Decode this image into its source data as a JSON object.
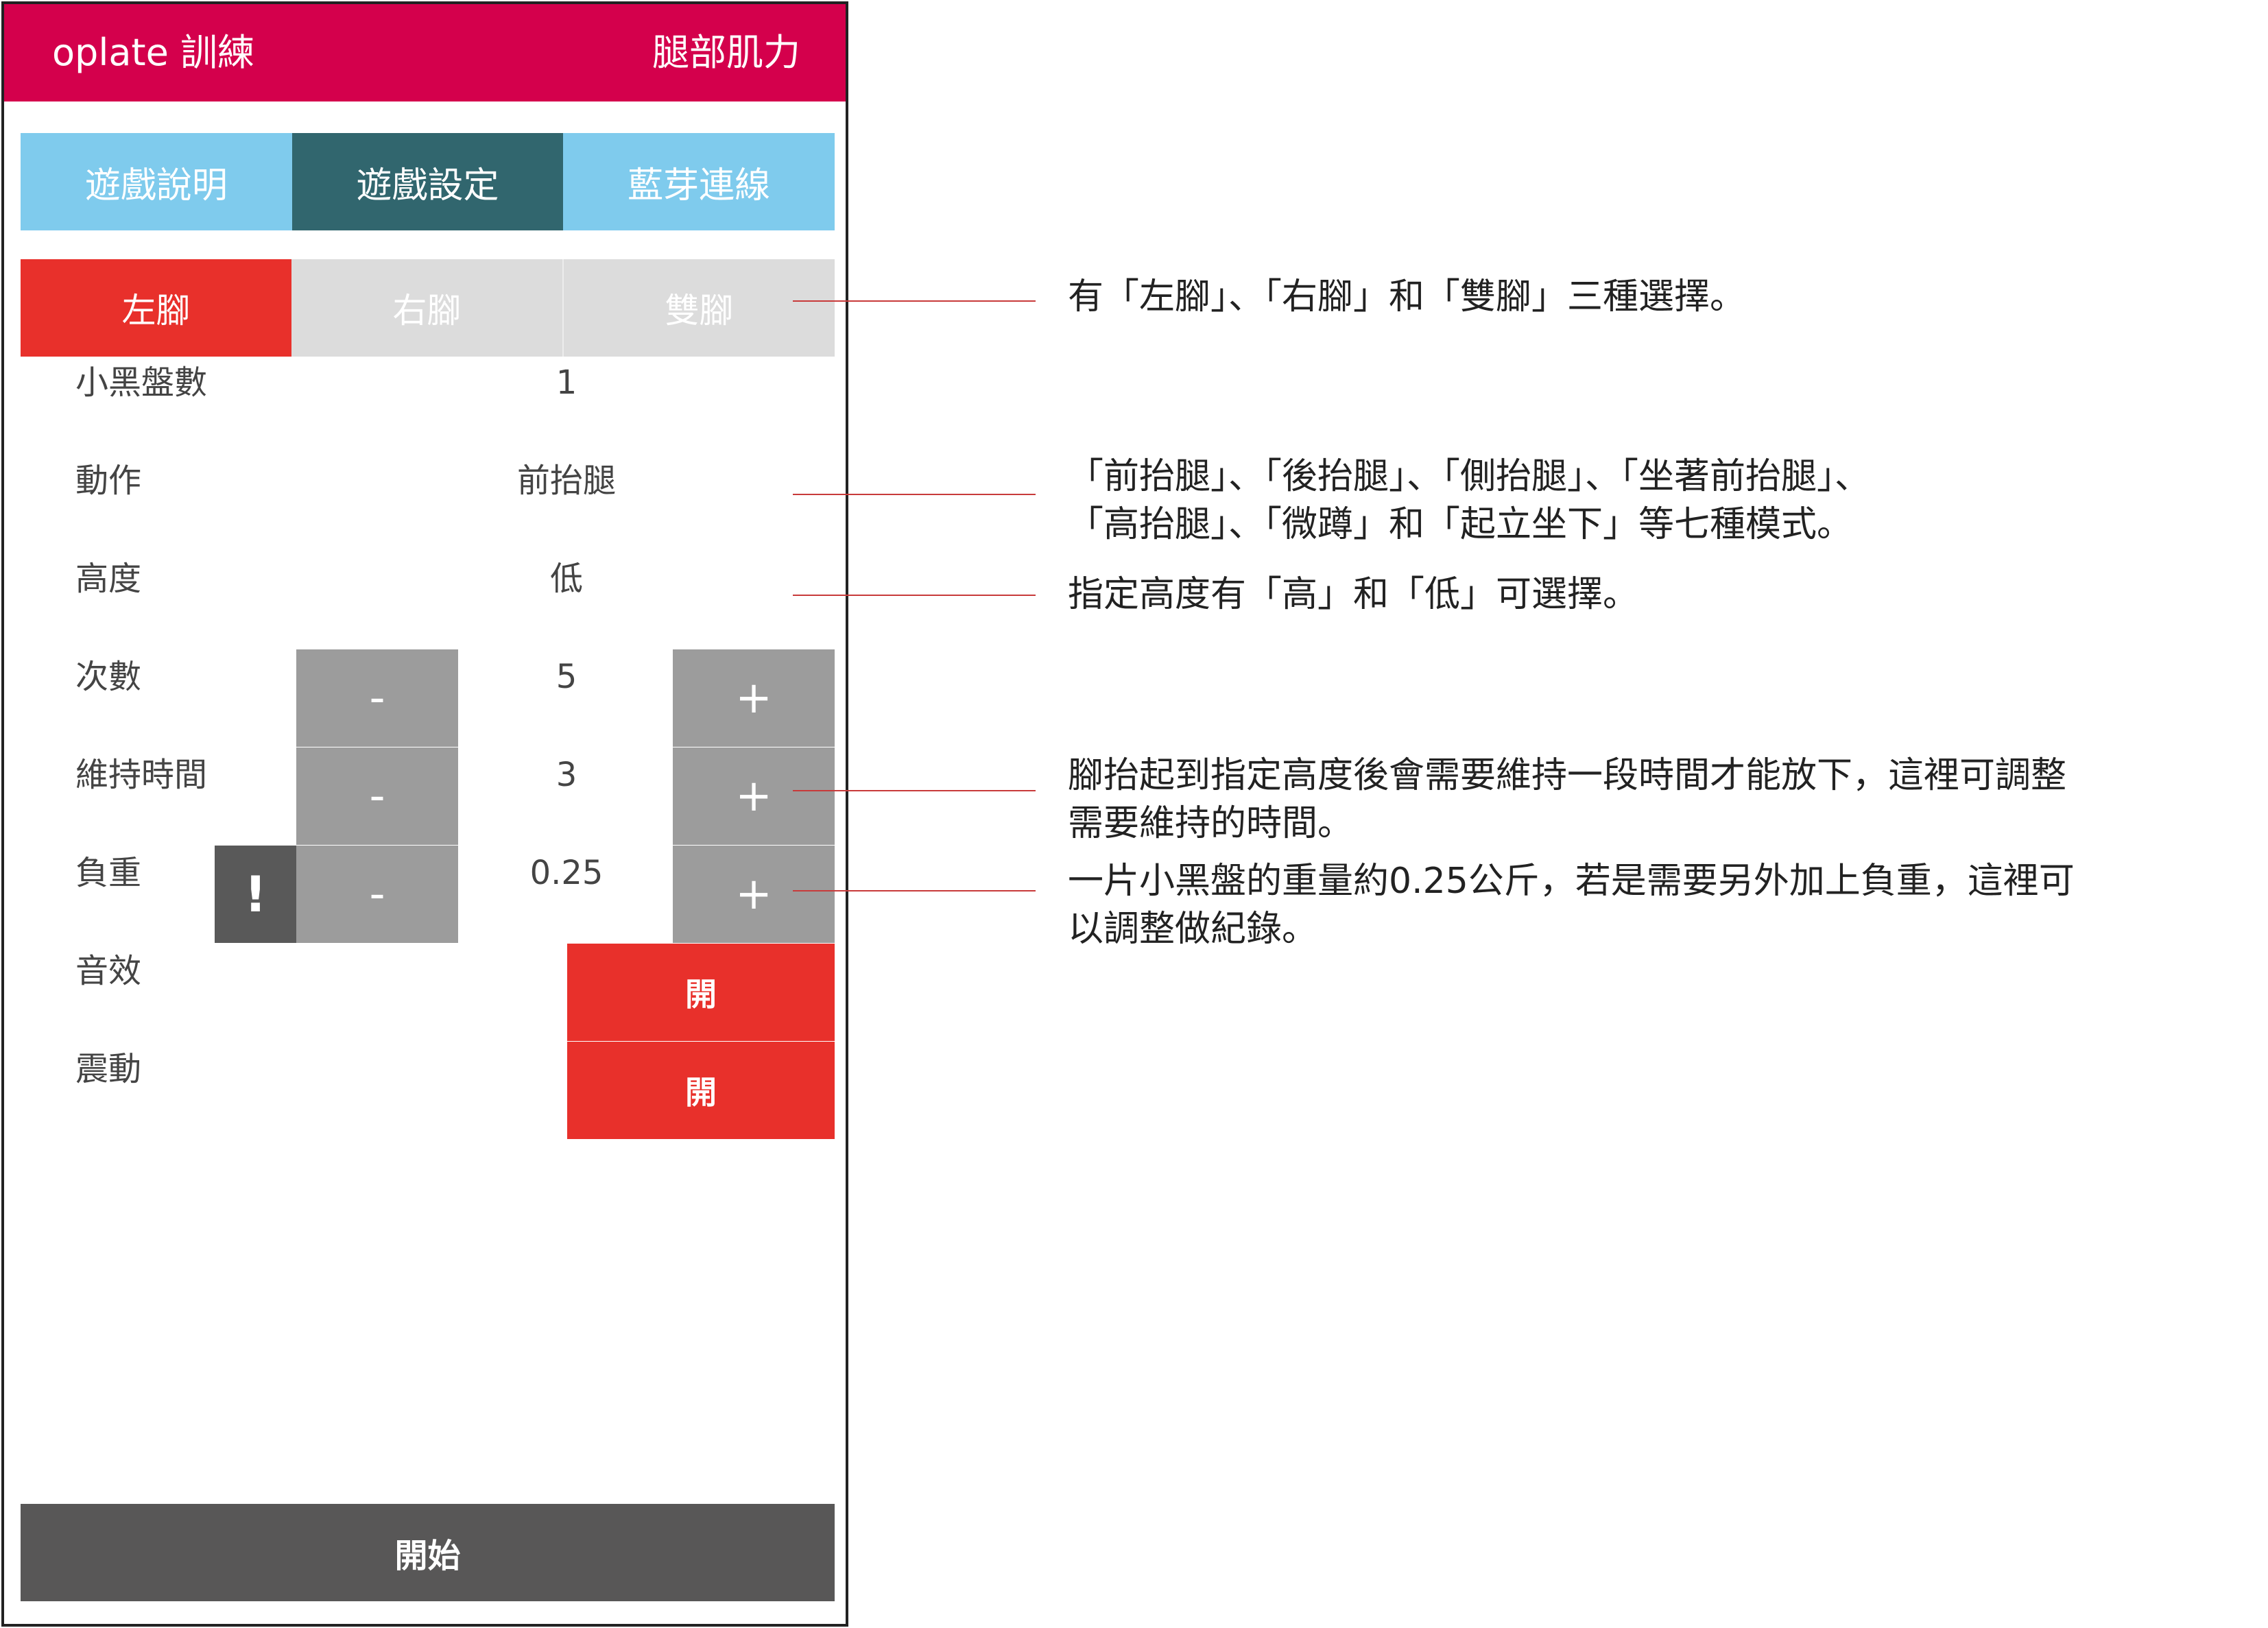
{
  "header": {
    "app_title": "oplate 訓練",
    "mode_title": "腿部肌力"
  },
  "tabs": [
    {
      "label": "遊戲說明"
    },
    {
      "label": "遊戲設定"
    },
    {
      "label": "藍芽連線"
    }
  ],
  "feet": [
    {
      "label": "左腳"
    },
    {
      "label": "右腳"
    },
    {
      "label": "雙腳"
    }
  ],
  "settings": {
    "plates": {
      "label": "小黑盤數",
      "value": "1"
    },
    "action": {
      "label": "動作",
      "value": "前抬腿"
    },
    "height": {
      "label": "高度",
      "value": "低"
    },
    "reps": {
      "label": "次數",
      "value": "5"
    },
    "hold": {
      "label": "維持時間",
      "value": "3"
    },
    "weight": {
      "label": "負重",
      "value": "0.25"
    },
    "sound": {
      "label": "音效",
      "value": "開"
    },
    "vibration": {
      "label": "震動",
      "value": "開"
    }
  },
  "controls": {
    "minus": "-",
    "plus": "+",
    "warn": "!"
  },
  "start_label": "開始",
  "notes": {
    "feet": [
      "有「左腳」、「右腳」和「雙腳」三種選擇。"
    ],
    "action": [
      "「前抬腿」、「後抬腿」、「側抬腿」、「坐著前抬腿」、",
      "「高抬腿」、「微蹲」和「起立坐下」等七種模式。"
    ],
    "height": [
      "指定高度有「高」和「低」可選擇。"
    ],
    "hold": [
      "腳抬起到指定高度後會需要維持一段時間才能放下，這裡可調整",
      "需要維持的時間。"
    ],
    "weight": [
      "一片小黑盤的重量約0.25公斤，若是需要另外加上負重，這裡可",
      "以調整做紀錄。"
    ]
  },
  "colors": {
    "header": "#d4004c",
    "tab_light": "#7fcbed",
    "tab_active": "#31666e",
    "selected": "#e8302b",
    "unselected": "#dcdcdc",
    "stepper": "#9c9c9c",
    "start": "#585757"
  }
}
